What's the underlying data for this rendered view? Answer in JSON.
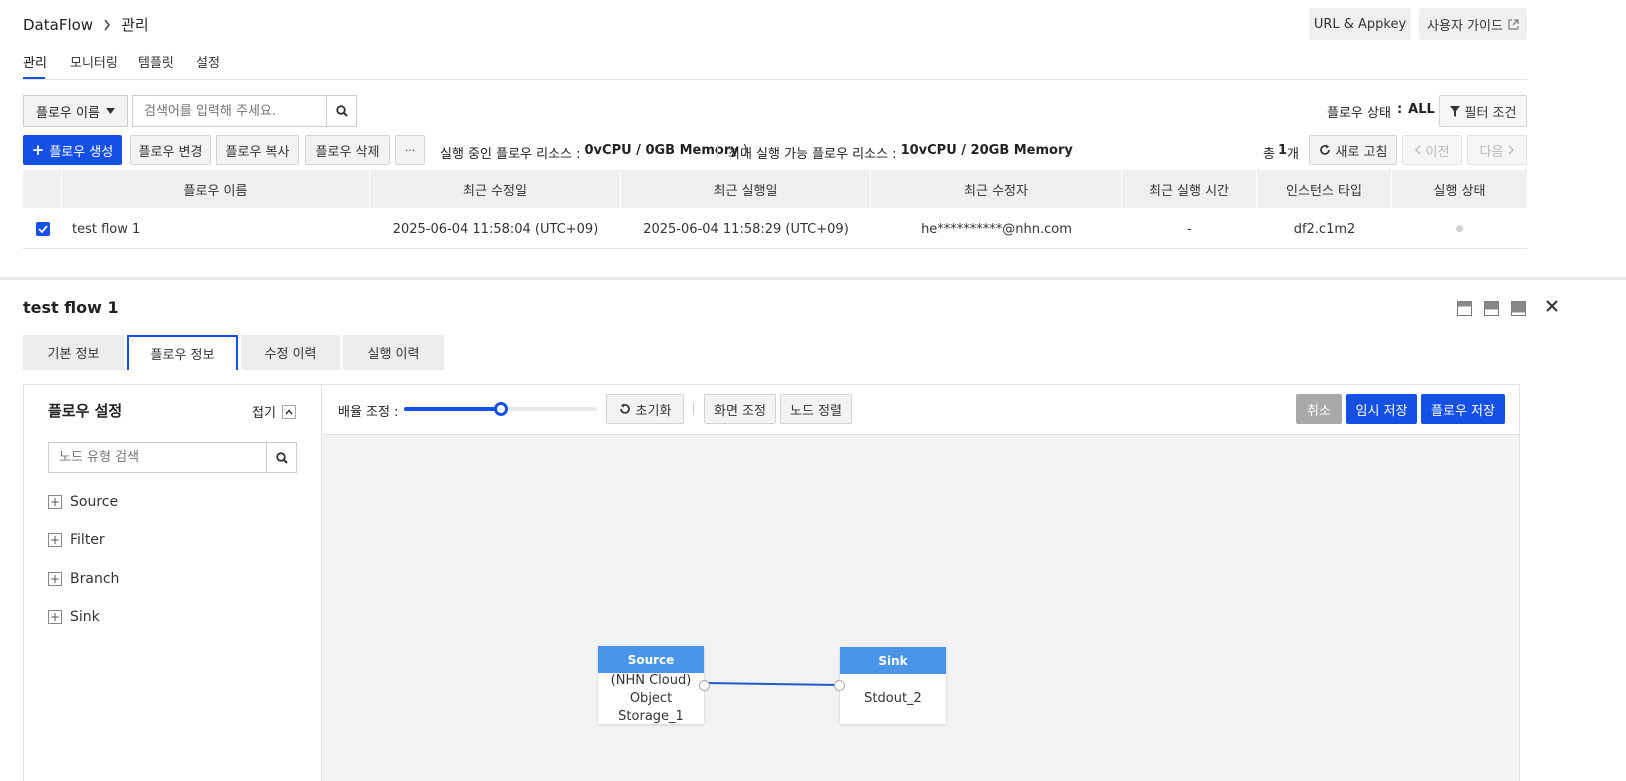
{
  "header": {
    "app": "DataFlow",
    "current": "관리",
    "url_appkey": "URL & Appkey",
    "user_guide": "사용자 가이드"
  },
  "top_tabs": [
    "관리",
    "모니터링",
    "템플릿",
    "설정"
  ],
  "search": {
    "select_value": "플로우 이름",
    "placeholder": "검색어를 입력해 주세요."
  },
  "status_filter": {
    "label": "플로우 상태",
    "colon": ":",
    "value": "ALL",
    "filter_button": "필터 조건"
  },
  "toolbar": {
    "create": "플로우 생성",
    "change": "플로우 변경",
    "copy": "플로우 복사",
    "delete": "플로우 삭제",
    "more": "···",
    "running_label": "실행 중인 플로우 리소스 :",
    "running_value": "0vCPU / 0GB Memory",
    "running_suffix": ")",
    "max_label": "최대 실행 가능 플로우 리소스 :",
    "max_value": "10vCPU / 20GB Memory",
    "total_prefix": "총",
    "total_count": "1",
    "total_suffix": "개",
    "refresh": "새로 고침",
    "prev": "이전",
    "next": "다음"
  },
  "table": {
    "columns": [
      "플로우 이름",
      "최근 수정일",
      "최근 실행일",
      "최근 수정자",
      "최근 실행 시간",
      "인스턴스 타입",
      "실행 상태"
    ],
    "rows": [
      {
        "checked": true,
        "name": "test flow 1",
        "modified": "2025-06-04 11:58:04 (UTC+09)",
        "executed": "2025-06-04 11:58:29 (UTC+09)",
        "modifier": "he**********@nhn.com",
        "exec_time": "-",
        "instance": "df2.c1m2",
        "status": "●"
      }
    ]
  },
  "detail": {
    "title": "test flow 1",
    "tabs": [
      "기본 정보",
      "플로우 정보",
      "수정 이력",
      "실행 이력"
    ],
    "active_tab": 1
  },
  "settings_panel": {
    "title": "플로우 설정",
    "collapse": "접기",
    "search_placeholder": "노드 유형 검색",
    "tree": [
      "Source",
      "Filter",
      "Branch",
      "Sink"
    ]
  },
  "canvas_toolbar": {
    "zoom_label": "배율 조정 :",
    "zoom_fraction": 0.5,
    "reset": "초기화",
    "fit": "화면 조정",
    "align": "노드 정렬",
    "cancel": "취소",
    "temp_save": "임시 저장",
    "save": "플로우 저장"
  },
  "nodes": [
    {
      "type": "Source",
      "line1": "(NHN Cloud)",
      "line2": "Object Storage_1"
    },
    {
      "type": "Sink",
      "line1": "Stdout_2"
    }
  ],
  "colors": {
    "primary": "#1550e6",
    "node_header": "#4a95e8",
    "edge": "#1e5bc6"
  }
}
